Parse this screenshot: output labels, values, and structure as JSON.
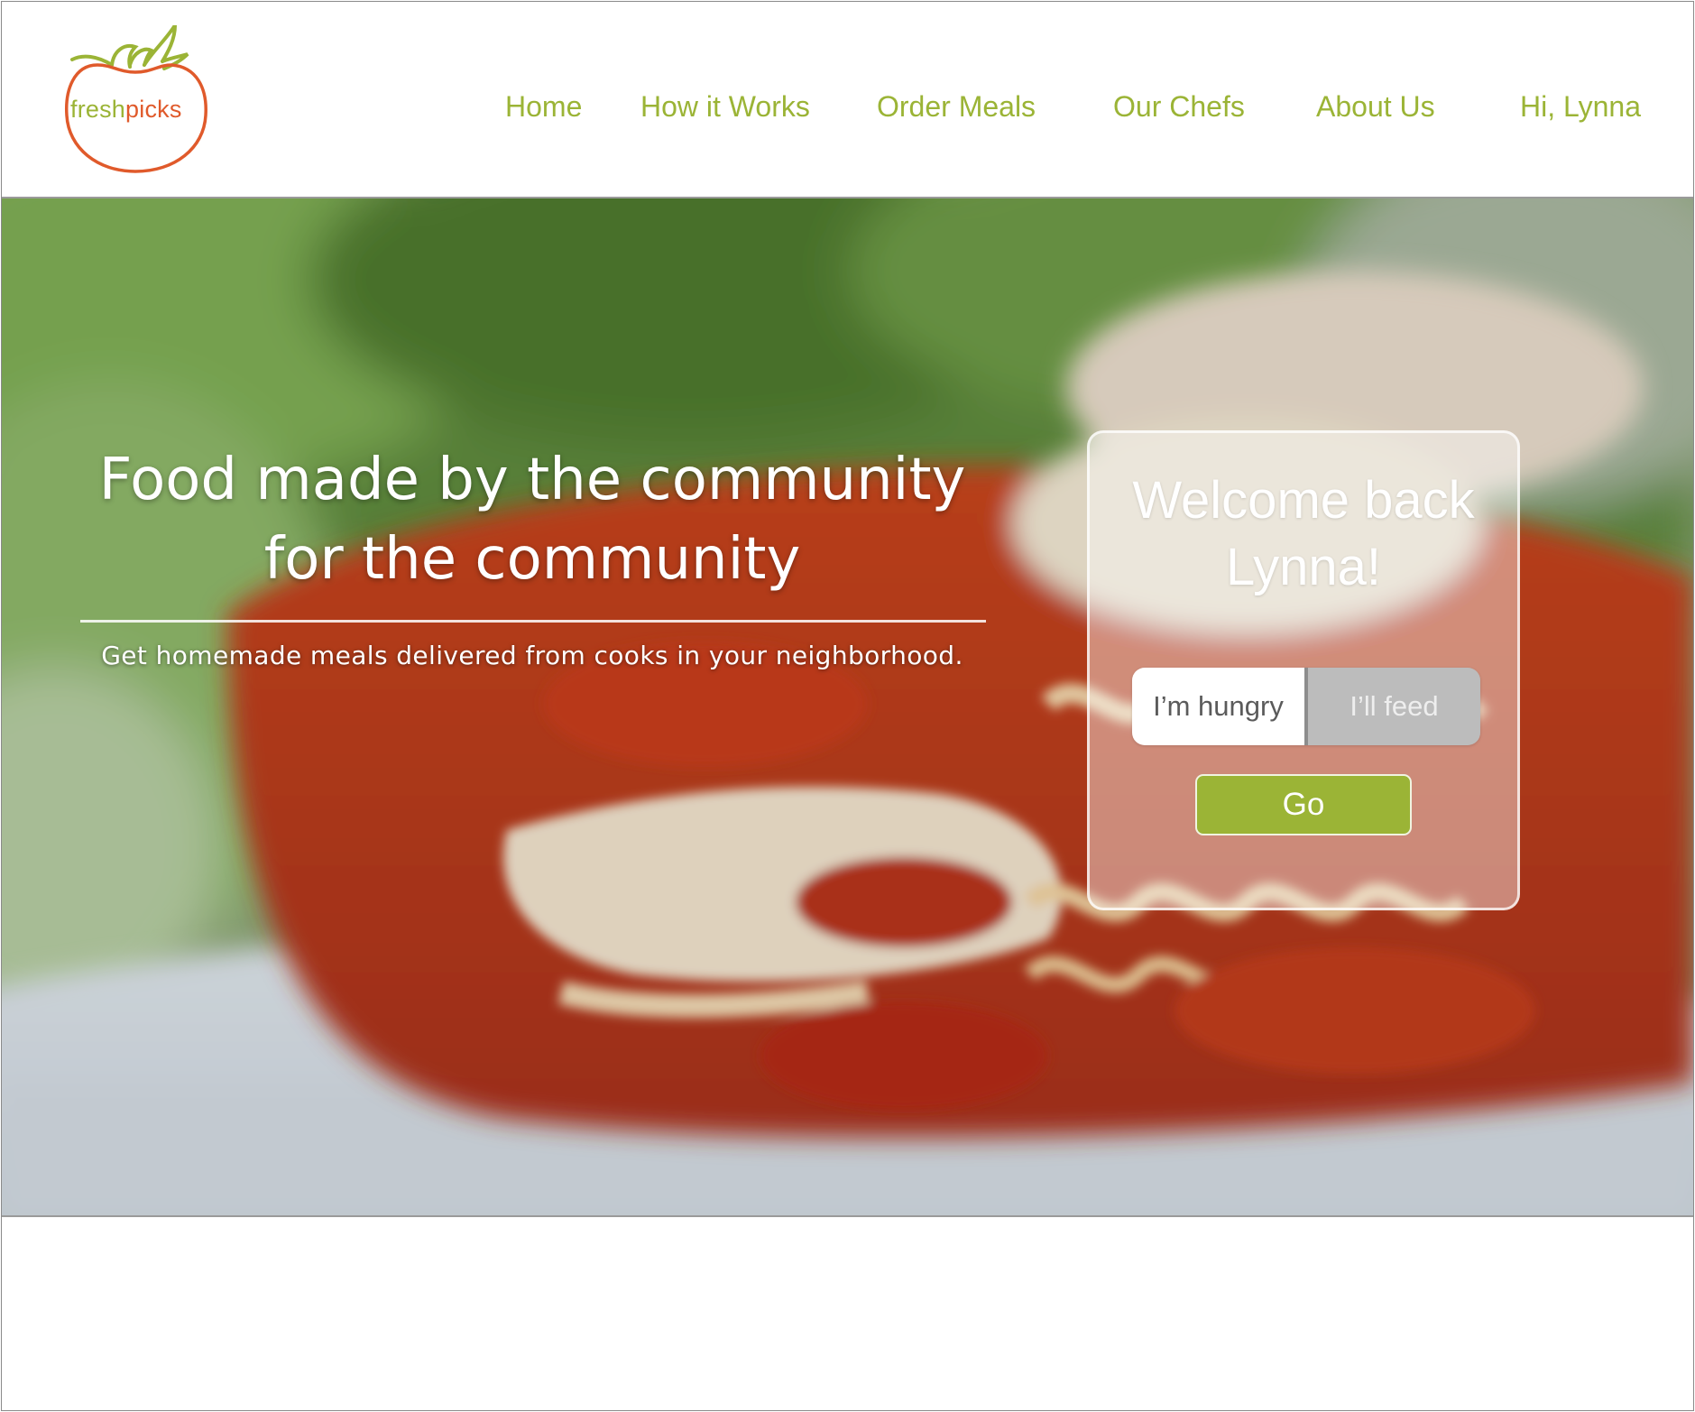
{
  "brand": {
    "logo_part1": "fresh",
    "logo_part2": "picks",
    "green": "#9bb436",
    "orange": "#e05a2b"
  },
  "nav": {
    "items": [
      {
        "label": "Home"
      },
      {
        "label": "How it Works"
      },
      {
        "label": "Order Meals"
      },
      {
        "label": "Our Chefs"
      },
      {
        "label": "About Us"
      },
      {
        "label": "Hi, Lynna"
      }
    ]
  },
  "hero": {
    "title_line1": "Food made by the community",
    "title_line2": "for the community",
    "subtitle": "Get homemade meals delivered from cooks in your neighborhood."
  },
  "welcome": {
    "title_line1": "Welcome back",
    "title_line2": "Lynna!",
    "toggle_options": [
      {
        "label": "I’m hungry",
        "selected": true
      },
      {
        "label": "I’ll feed",
        "selected": false
      }
    ],
    "go_label": "Go"
  }
}
